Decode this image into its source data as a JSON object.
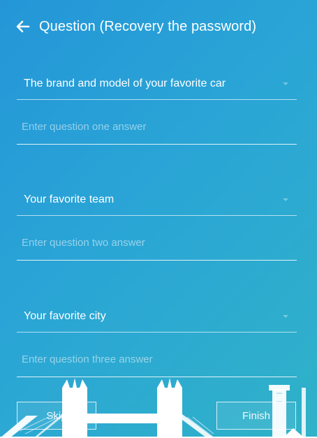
{
  "header": {
    "title": "Question (Recovery the password)",
    "back_icon": "arrow-left-icon"
  },
  "questions": [
    {
      "question": "The brand and model of your favorite car",
      "placeholder": "Enter question one answer",
      "value": ""
    },
    {
      "question": "Your favorite team",
      "placeholder": "Enter question two answer",
      "value": ""
    },
    {
      "question": "Your favorite city",
      "placeholder": "Enter question three answer",
      "value": ""
    }
  ],
  "buttons": {
    "skip": "Skip",
    "finish": "Finish"
  },
  "colors": {
    "background_start": "#2496d8",
    "background_end": "#30b2c8"
  }
}
